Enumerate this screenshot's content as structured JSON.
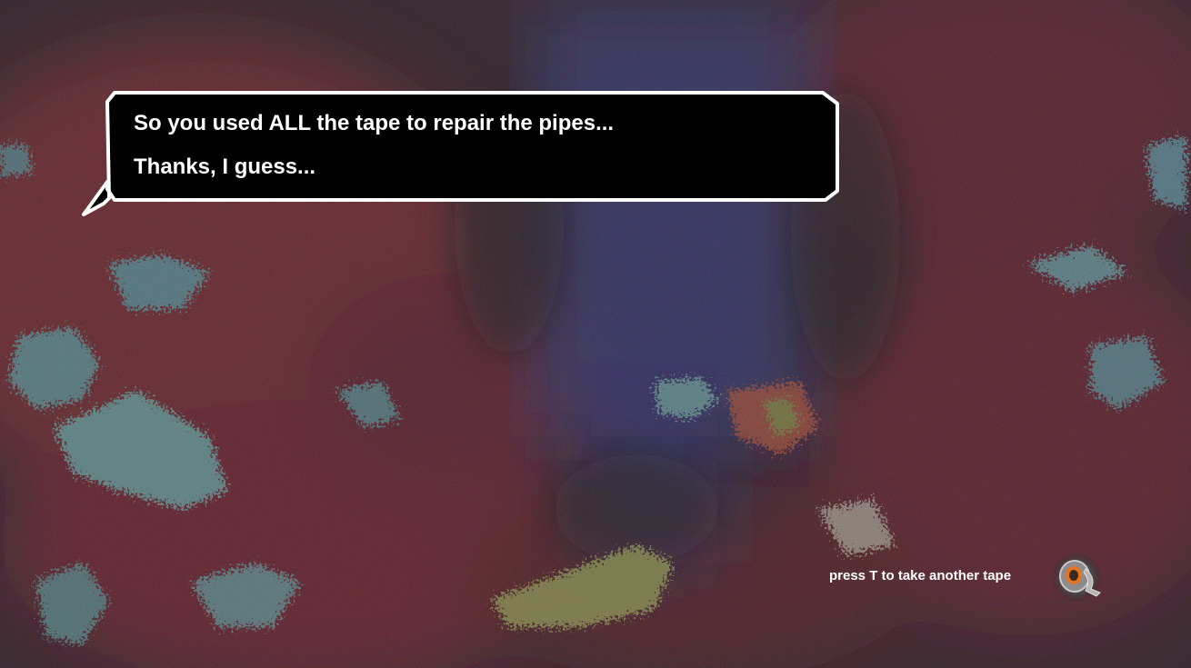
{
  "dialog": {
    "lines": [
      "So you used ALL the tape to repair the pipes...",
      "Thanks, I guess..."
    ]
  },
  "hint": {
    "text": "press T to take another tape",
    "icon": "duct-tape-icon"
  },
  "colors": {
    "background": "#140d0f",
    "rust_red": "#7a1616",
    "teal_patch": "#3f7f7e",
    "blue_glow": "#1a2f6a",
    "tape_orange": "#e8731f",
    "dialog_fill": "#000000",
    "dialog_border": "#ffffff",
    "text": "#ffffff"
  }
}
